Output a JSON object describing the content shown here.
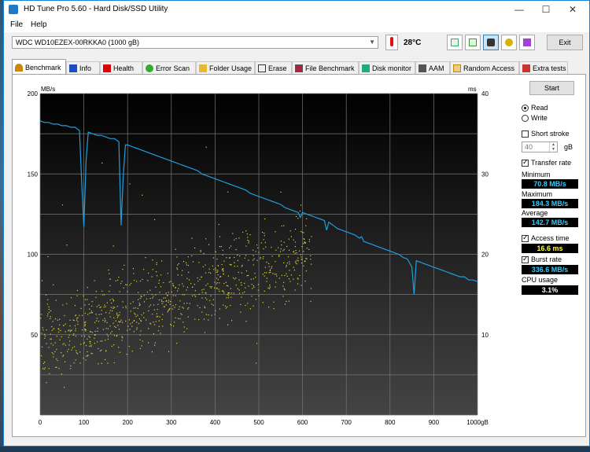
{
  "window": {
    "title": "HD Tune Pro 5.60 - Hard Disk/SSD Utility"
  },
  "menu": {
    "file": "File",
    "help": "Help"
  },
  "toolbar": {
    "drive": "WDC WD10EZEX-00RKKA0 (1000 gB)",
    "temperature": "28°C",
    "exit_label": "Exit",
    "icons": [
      "copy-info-icon",
      "copy-text-icon",
      "screenshot-icon",
      "options-icon",
      "save-icon"
    ]
  },
  "tabs": [
    {
      "label": "Benchmark",
      "icon": "benchmark-icon"
    },
    {
      "label": "Info",
      "icon": "info-icon"
    },
    {
      "label": "Health",
      "icon": "health-icon"
    },
    {
      "label": "Error Scan",
      "icon": "error-scan-icon"
    },
    {
      "label": "Folder Usage",
      "icon": "folder-icon"
    },
    {
      "label": "Erase",
      "icon": "erase-icon"
    },
    {
      "label": "File Benchmark",
      "icon": "file-benchmark-icon"
    },
    {
      "label": "Disk monitor",
      "icon": "disk-monitor-icon"
    },
    {
      "label": "AAM",
      "icon": "speaker-icon"
    },
    {
      "label": "Random Access",
      "icon": "random-access-icon"
    },
    {
      "label": "Extra tests",
      "icon": "extra-tests-icon"
    }
  ],
  "side": {
    "start_label": "Start",
    "read_label": "Read",
    "write_label": "Write",
    "short_stroke_label": "Short stroke",
    "short_stroke_value": "40",
    "gb_label": "gB",
    "transfer_rate_label": "Transfer rate",
    "minimum_label": "Minimum",
    "minimum_value": "70.8 MB/s",
    "maximum_label": "Maximum",
    "maximum_value": "184.3 MB/s",
    "average_label": "Average",
    "average_value": "142.7 MB/s",
    "access_time_label": "Access time",
    "access_time_value": "16.6 ms",
    "burst_rate_label": "Burst rate",
    "burst_rate_value": "336.6 MB/s",
    "cpu_usage_label": "CPU usage",
    "cpu_usage_value": "3.1%"
  },
  "colors": {
    "transfer": "#1e9fe0",
    "access": "#d8d838",
    "cyan_text": "#33ccff",
    "yellow_text": "#ffff33"
  },
  "chart_data": {
    "type": "line",
    "ylabel": "MB/s",
    "y2label": "ms",
    "xlim": [
      0,
      1000
    ],
    "ylim": [
      0,
      200
    ],
    "y2lim": [
      0,
      40
    ],
    "x_ticks": [
      "0",
      "100",
      "200",
      "300",
      "400",
      "500",
      "600",
      "700",
      "800",
      "900",
      "1000gB"
    ],
    "y_ticks": [
      "200",
      "150",
      "100",
      "50"
    ],
    "y2_ticks": [
      "40",
      "30",
      "20",
      "10"
    ],
    "grid": true,
    "series": [
      {
        "axis": "left",
        "x": [
          0,
          10,
          20,
          30,
          40,
          50,
          60,
          70,
          80,
          90,
          95,
          100,
          105,
          110,
          120,
          130,
          140,
          150,
          160,
          170,
          180,
          185,
          190,
          195,
          200,
          210,
          220,
          230,
          240,
          250,
          260,
          270,
          280,
          290,
          300,
          310,
          320,
          330,
          340,
          350,
          360,
          370,
          380,
          390,
          400,
          410,
          420,
          430,
          440,
          450,
          460,
          470,
          480,
          490,
          500,
          510,
          520,
          530,
          540,
          550,
          560,
          570,
          580,
          590,
          595,
          600,
          610,
          620,
          630,
          640,
          650,
          655,
          660,
          670,
          680,
          690,
          700,
          710,
          720,
          730,
          735,
          740,
          750,
          760,
          770,
          780,
          790,
          800,
          810,
          820,
          830,
          840,
          850,
          855,
          860,
          870,
          880,
          890,
          900,
          910,
          920,
          930,
          940,
          950,
          960,
          970,
          980,
          990,
          1000
        ],
        "y": [
          183,
          182,
          182,
          181,
          181,
          180,
          180,
          179,
          179,
          177,
          145,
          117,
          158,
          176,
          175,
          174,
          174,
          173,
          172,
          172,
          170,
          118,
          148,
          168,
          168,
          167,
          166,
          165,
          164,
          163,
          162,
          161,
          160,
          159,
          158,
          157,
          156,
          155,
          154,
          153,
          152,
          150,
          149,
          148,
          147,
          146,
          145,
          144,
          143,
          142,
          141,
          140,
          138,
          137,
          136,
          135,
          134,
          133,
          132,
          131,
          129,
          128,
          127,
          126,
          123,
          126,
          125,
          124,
          123,
          122,
          121,
          115,
          120,
          118,
          116,
          115,
          114,
          113,
          112,
          110,
          111,
          108,
          107,
          106,
          105,
          104,
          103,
          102,
          101,
          100,
          98,
          97,
          92,
          75,
          96,
          95,
          94,
          93,
          92,
          91,
          90,
          89,
          88,
          87,
          86,
          86,
          84,
          84,
          83
        ]
      },
      {
        "axis": "right",
        "type": "scatter",
        "x_range": [
          0,
          620
        ],
        "y_range_ms": [
          6,
          24
        ],
        "trend_ms": "rises from ~9 ms near 0 gB to ~20 ms near 600 gB"
      }
    ]
  }
}
